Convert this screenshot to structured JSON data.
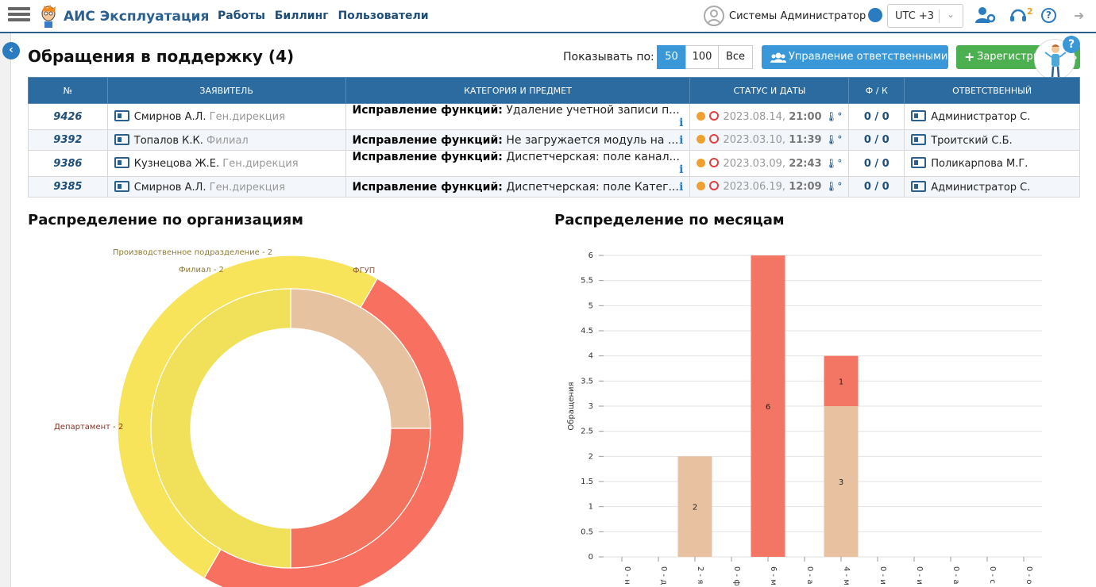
{
  "app": {
    "title": "АИС Эксплуатация"
  },
  "nav": [
    "Работы",
    "Биллинг",
    "Пользователи"
  ],
  "user": {
    "name": "Системы Администратор"
  },
  "timezone": "UTC +3",
  "notifications": {
    "count": "2"
  },
  "page": {
    "title": "Обращения в поддержку (4)",
    "show_by_label": "Показывать по:",
    "page_sizes": [
      "50",
      "100",
      "Все"
    ],
    "active_page_size": "50",
    "manage_btn": "Управление ответственными",
    "register_btn": "Зарегистрировать"
  },
  "table": {
    "headers": [
      "№",
      "ЗАЯВИТЕЛЬ",
      "КАТЕГОРИЯ И ПРЕДМЕТ",
      "СТАТУС И ДАТЫ",
      "Ф / К",
      "ОТВЕТСТВЕННЫЙ"
    ],
    "rows": [
      {
        "num": "9426",
        "applicant": "Смирнов А.Л.",
        "dept": "Ген.дирекция",
        "category": "Исправление функций:",
        "subject": "Удаление учетной записи п...",
        "date": "2023.08.14,",
        "time": "21:00",
        "fk": "0 / 0",
        "responsible": "Администратор С."
      },
      {
        "num": "9392",
        "applicant": "Топалов К.К.",
        "dept": "Филиал",
        "category": "Исправление функций:",
        "subject": "Не загружается модуль на ...",
        "date": "2023.03.10,",
        "time": "11:39",
        "fk": "0 / 0",
        "responsible": "Троитский С.Б."
      },
      {
        "num": "9386",
        "applicant": "Кузнецова Ж.Е.",
        "dept": "Ген.дирекция",
        "category": "Исправление функций:",
        "subject": "Диспетчерская: поле канал...",
        "date": "2023.03.09,",
        "time": "22:43",
        "fk": "0 / 0",
        "responsible": "Поликарпова М.Г."
      },
      {
        "num": "9385",
        "applicant": "Смирнов А.Л.",
        "dept": "Ген.дирекция",
        "category": "Исправление функций:",
        "subject": "Диспетчерская: поле Катег...",
        "date": "2023.06.19,",
        "time": "12:09",
        "fk": "0 / 0",
        "responsible": "Администратор С."
      }
    ]
  },
  "sections": {
    "orgs_title": "Распределение по организациям",
    "months_title": "Распределение по месяцам"
  },
  "chart_data": [
    {
      "type": "pie",
      "title": "Распределение по организациям",
      "outer_ring": [
        {
          "label": "Производственное подразделение - 2",
          "value": 2,
          "color": "#f7e45a"
        },
        {
          "label": "Департамент - 2",
          "value": 2,
          "color": "#f87060"
        }
      ],
      "inner_ring": [
        {
          "label": "Филиал - 2",
          "value": 2,
          "color": "#f1e05a"
        },
        {
          "label": "Департамент",
          "value": 1,
          "color": "#f3735f"
        },
        {
          "label": "ФГУП",
          "value": 1,
          "color": "#e7c2a0"
        }
      ],
      "visible_labels": [
        "Производственное подразделение - 2",
        "Филиал - 2",
        "ФГУП",
        "Департамент - 2"
      ]
    },
    {
      "type": "bar",
      "title": "Распределение по месяцам",
      "ylabel": "Обращения",
      "ylim": [
        0,
        6
      ],
      "yticks": [
        "0",
        "0.5",
        "1",
        "1.5",
        "2",
        "2.5",
        "3",
        "3.5",
        "4",
        "4.5",
        "5",
        "5.5",
        "6"
      ],
      "categories": [
        "0 - н",
        "0 - д",
        "2 - я",
        "0 - ф",
        "6 - м",
        "0 - а",
        "4 - м",
        "0 - и",
        "0 - и",
        "0 - а",
        "0 - с",
        "0 - о"
      ],
      "series": [
        {
          "values": [
            0,
            0,
            2,
            0,
            0,
            0,
            3,
            0,
            0,
            0,
            0,
            0
          ],
          "color": "#e8c2a0"
        },
        {
          "values": [
            0,
            0,
            0,
            0,
            6,
            0,
            1,
            0,
            0,
            0,
            0,
            0
          ],
          "color": "#f27663"
        }
      ],
      "segment_labels": [
        "2",
        "6",
        "3",
        "1"
      ]
    }
  ]
}
